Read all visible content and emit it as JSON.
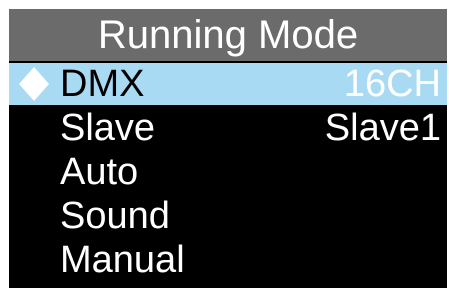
{
  "header": {
    "title": "Running Mode"
  },
  "menu": {
    "items": [
      {
        "label": "DMX",
        "value": "16CH",
        "selected": true
      },
      {
        "label": "Slave",
        "value": "Slave1",
        "selected": false
      },
      {
        "label": "Auto",
        "value": "",
        "selected": false
      },
      {
        "label": "Sound",
        "value": "",
        "selected": false
      },
      {
        "label": "Manual",
        "value": "",
        "selected": false
      }
    ],
    "cursor_icon": "diamond-icon"
  },
  "colors": {
    "screen_background": "#000000",
    "title_background": "#6b6b6b",
    "selection_highlight": "#a9daf4",
    "text": "#ffffff",
    "selected_label_text": "#000000"
  }
}
